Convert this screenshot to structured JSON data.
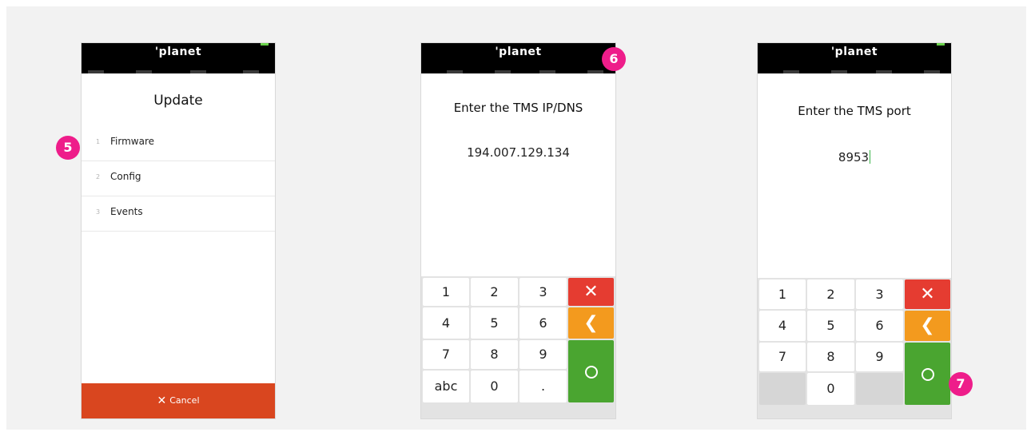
{
  "brand": "'planet",
  "accent_colors": {
    "background": "#f2f2f2",
    "topbar": "#000000",
    "cancel": "#d9461f",
    "key_cancel": "#e53c31",
    "key_back": "#f39a1e",
    "key_ok": "#4aa530",
    "badge": "#ee1d8a",
    "cursor": "#3bb54a"
  },
  "screen1": {
    "title": "Update",
    "items": [
      {
        "num": "1",
        "label": "Firmware"
      },
      {
        "num": "2",
        "label": "Config"
      },
      {
        "num": "3",
        "label": "Events"
      }
    ],
    "cancel_icon": "✕",
    "cancel_label": "Cancel"
  },
  "screen2": {
    "title": "Enter the TMS IP/DNS",
    "value": "194.007.129.134"
  },
  "screen3": {
    "title": "Enter the TMS port",
    "value": "8953"
  },
  "keypad": {
    "k1": "1",
    "k2": "2",
    "k3": "3",
    "k4": "4",
    "k5": "5",
    "k6": "6",
    "k7": "7",
    "k8": "8",
    "k9": "9",
    "abc": "abc",
    "k0": "0",
    "dot": ".",
    "cancel_glyph": "✕",
    "back_glyph": "❮",
    "icons": {
      "cancel": "close-icon",
      "back": "chevron-left-icon",
      "ok": "circle-ok-icon"
    }
  },
  "badges": {
    "step5": "5",
    "step6": "6",
    "step7": "7"
  }
}
